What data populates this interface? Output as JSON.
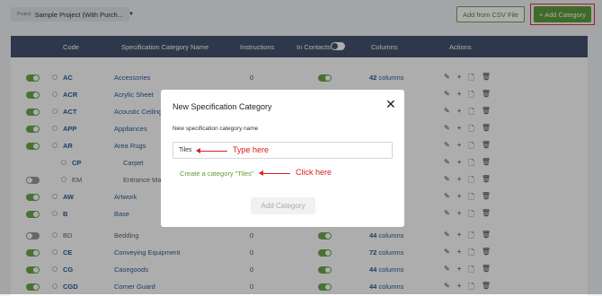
{
  "topbar": {
    "project_label": "Project",
    "project_value": "Sample Project (With Purch...",
    "add_csv": "Add from CSV File",
    "add_category": "+ Add Category"
  },
  "table": {
    "headers": {
      "code": "Code",
      "name": "Specification Category Name",
      "instructions": "Instructions",
      "contacts": "In Contacts",
      "columns": "Columns",
      "actions": "Actions"
    },
    "rows": [
      {
        "code": "AC",
        "name": "Accessories",
        "instr": "0",
        "cols": "42",
        "cols_suffix": "columns"
      },
      {
        "code": "ACR",
        "name": "Acrylic Sheet",
        "instr": "",
        "cols": "",
        "cols_suffix": ""
      },
      {
        "code": "ACT",
        "name": "Acoustic Ceiling",
        "instr": "",
        "cols": "",
        "cols_suffix": ""
      },
      {
        "code": "APP",
        "name": "Appliances",
        "instr": "",
        "cols": "",
        "cols_suffix": ""
      },
      {
        "code": "AR",
        "name": "Area Rugs",
        "instr": "",
        "cols": "",
        "cols_suffix": ""
      },
      {
        "code": "CP",
        "name": "Carpet",
        "instr": "",
        "cols": "",
        "cols_suffix": ""
      },
      {
        "code": "EM",
        "name": "Entrance Mat",
        "instr": "",
        "cols": "",
        "cols_suffix": ""
      },
      {
        "code": "AW",
        "name": "Artwork",
        "instr": "",
        "cols": "",
        "cols_suffix": ""
      },
      {
        "code": "B",
        "name": "Base",
        "instr": "",
        "cols": "",
        "cols_suffix": ""
      },
      {
        "code": "BD",
        "name": "Bedding",
        "instr": "0",
        "cols": "44",
        "cols_suffix": "columns"
      },
      {
        "code": "CE",
        "name": "Conveying Equipment",
        "instr": "0",
        "cols": "72",
        "cols_suffix": "columns"
      },
      {
        "code": "CG",
        "name": "Casegoods",
        "instr": "0",
        "cols": "44",
        "cols_suffix": "columns"
      },
      {
        "code": "CGD",
        "name": "Corner Guard",
        "instr": "0",
        "cols": "44",
        "cols_suffix": "columns"
      }
    ]
  },
  "modal": {
    "title": "New Specification Category",
    "label": "New specification category name",
    "input_value": "Tiles",
    "create_link": "Create a category \"Tiles\"",
    "submit": "Add Category",
    "annotation_type": "Type here",
    "annotation_click": "Click here"
  },
  "colors": {
    "header_bg": "#45536e",
    "accent_green": "#5e9c3a",
    "annotation_red": "#d8201e",
    "link_blue": "#2f5b9a"
  }
}
